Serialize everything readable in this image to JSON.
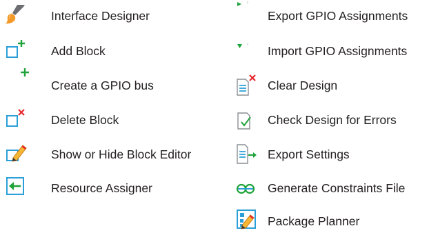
{
  "colors": {
    "text": "#231f20",
    "green": "#1fa33a",
    "red": "#e8262d",
    "blue": "#2a9fd8",
    "orange": "#f39a2b",
    "gray": "#8a8f94"
  },
  "left_items": [
    {
      "label": "Interface Designer",
      "icon": "paintbrush-icon"
    },
    {
      "label": "Add Block",
      "icon": "add-block-icon"
    },
    {
      "label": "Create a GPIO bus",
      "icon": "create-bus-icon"
    },
    {
      "label": "Delete Block",
      "icon": "delete-block-icon"
    },
    {
      "label": "Show or Hide Block Editor",
      "icon": "block-editor-icon"
    },
    {
      "label": "Resource Assigner",
      "icon": "resource-assigner-icon"
    }
  ],
  "right_items": [
    {
      "label": "Export GPIO Assignments",
      "icon": "export-gpio-icon"
    },
    {
      "label": "Import GPIO Assignments",
      "icon": "import-gpio-icon"
    },
    {
      "label": "Clear Design",
      "icon": "clear-design-icon"
    },
    {
      "label": "Check Design for Errors",
      "icon": "check-design-icon"
    },
    {
      "label": "Export Settings",
      "icon": "export-settings-icon"
    },
    {
      "label": "Generate Constraints File",
      "icon": "constraints-file-icon"
    },
    {
      "label": "Package Planner",
      "icon": "package-planner-icon"
    }
  ]
}
